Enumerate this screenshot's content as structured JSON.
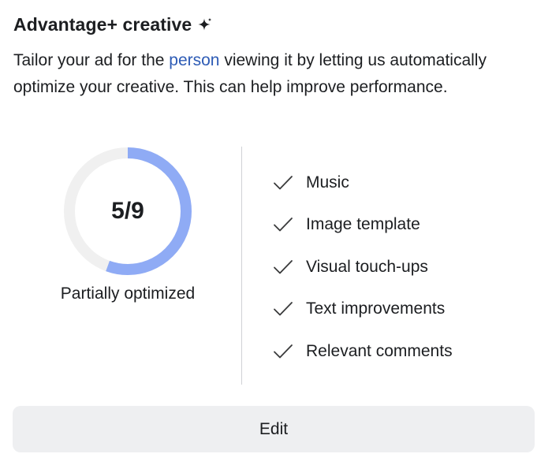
{
  "header": {
    "title": "Advantage+ creative",
    "title_icon": "sparkle-icon"
  },
  "description": {
    "before_link": "Tailor your ad for the ",
    "link_text": "person",
    "after_link": " viewing it by letting us automatically optimize your creative. This can help improve performance."
  },
  "progress": {
    "label": "5/9",
    "completed": 5,
    "total": 9,
    "caption": "Partially optimized",
    "colors": {
      "filled": "#8fabf5",
      "track": "#f0f0f0"
    }
  },
  "features": [
    {
      "label": "Music",
      "icon": "checkmark-icon"
    },
    {
      "label": "Image template",
      "icon": "checkmark-icon"
    },
    {
      "label": "Visual touch-ups",
      "icon": "checkmark-icon"
    },
    {
      "label": "Text improvements",
      "icon": "checkmark-icon"
    },
    {
      "label": "Relevant comments",
      "icon": "checkmark-icon"
    }
  ],
  "actions": {
    "edit_label": "Edit"
  },
  "colors": {
    "link": "#2d5bb5",
    "text": "#1c1e21",
    "button_bg": "#eeeff1",
    "divider": "#d0d2d6"
  }
}
